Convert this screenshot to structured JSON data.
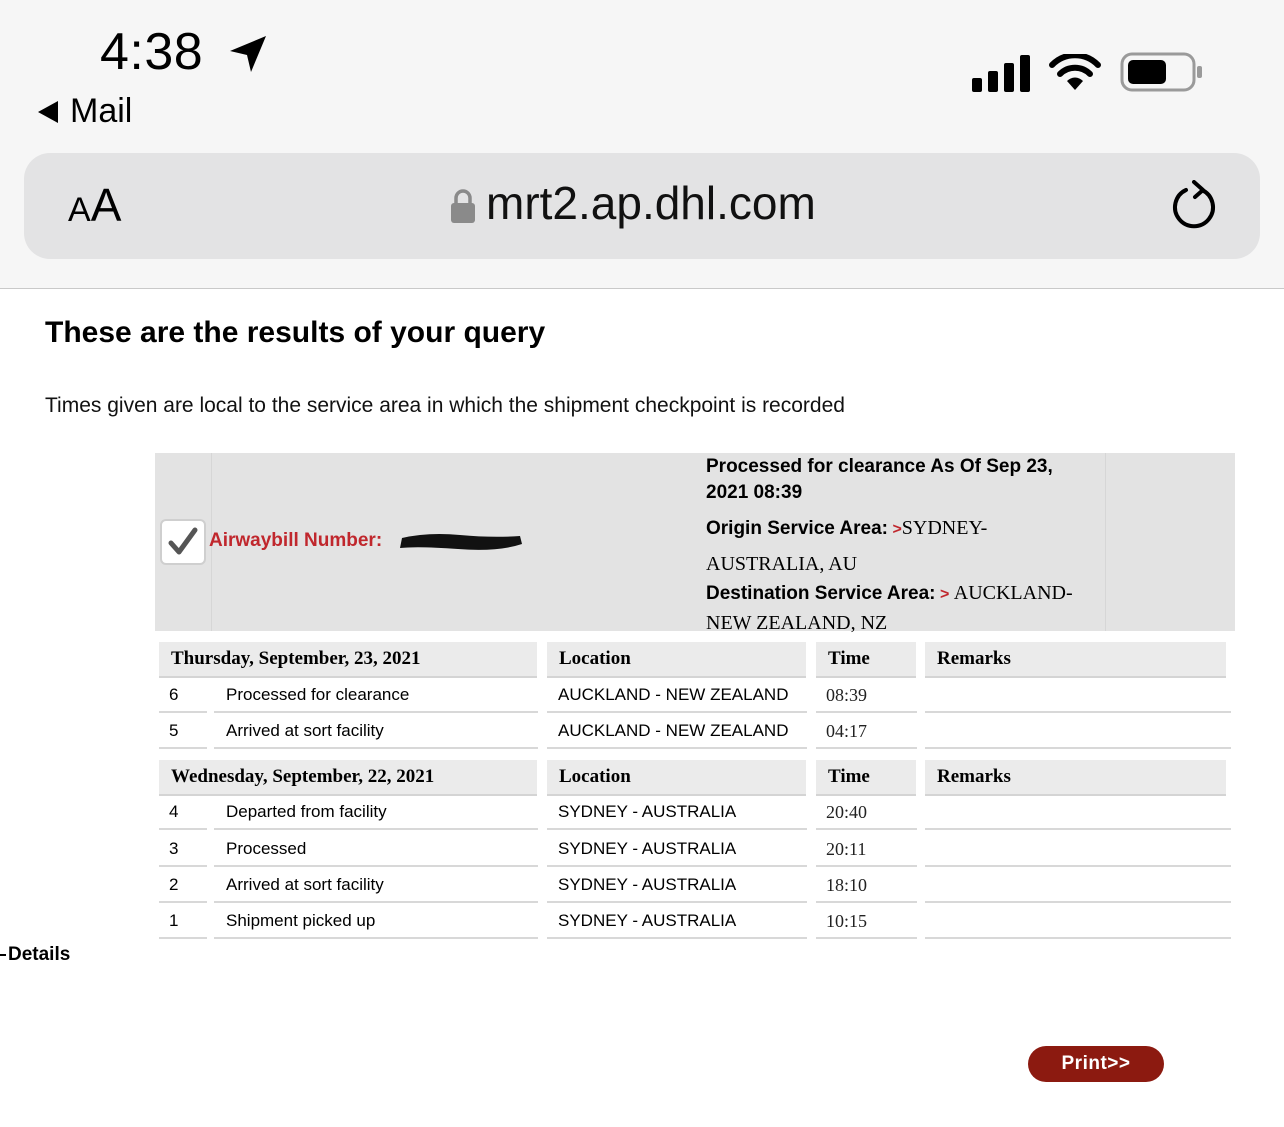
{
  "status_bar": {
    "time": "4:38",
    "back_label": "Mail",
    "icons": [
      "location-arrow-icon",
      "cellular-signal-icon",
      "wifi-icon",
      "battery-icon"
    ]
  },
  "browser": {
    "text_size_label_small": "A",
    "text_size_label_large": "A",
    "url": "mrt2.ap.dhl.com",
    "icons": [
      "lock-icon",
      "reload-icon"
    ]
  },
  "page": {
    "heading": "These are the results of your query",
    "subtitle": "Times given are local to the service area in which the shipment checkpoint is recorded",
    "summary": {
      "awb_label": "Airwaybill Number:",
      "status": "Processed for clearance As Of Sep 23, 2021 08:39",
      "origin_label": "Origin Service Area:",
      "origin_chevron": ">",
      "origin_value": "SYDNEY-AUSTRALIA, AU",
      "destination_label": "Destination Service Area:",
      "destination_chevron": ">",
      "destination_value": "AUCKLAND-NEW ZEALAND, NZ"
    },
    "groups": [
      {
        "date": "Thursday, September, 23, 2021",
        "location_header": "Location",
        "time_header": "Time",
        "remarks_header": "Remarks",
        "rows": [
          {
            "num": "6",
            "event": "Processed for clearance",
            "location": "AUCKLAND - NEW ZEALAND",
            "time": "08:39",
            "remarks": ""
          },
          {
            "num": "5",
            "event": "Arrived at sort facility",
            "location": "AUCKLAND - NEW ZEALAND",
            "time": "04:17",
            "remarks": ""
          }
        ]
      },
      {
        "date": "Wednesday, September, 22, 2021",
        "location_header": "Location",
        "time_header": "Time",
        "remarks_header": "Remarks",
        "rows": [
          {
            "num": "4",
            "event": "Departed from facility",
            "location": "SYDNEY - AUSTRALIA",
            "time": "20:40",
            "remarks": ""
          },
          {
            "num": "3",
            "event": "Processed",
            "location": "SYDNEY - AUSTRALIA",
            "time": "20:11",
            "remarks": ""
          },
          {
            "num": "2",
            "event": "Arrived at sort facility",
            "location": "SYDNEY - AUSTRALIA",
            "time": "18:10",
            "remarks": ""
          },
          {
            "num": "1",
            "event": "Shipment picked up",
            "location": "SYDNEY - AUSTRALIA",
            "time": "10:15",
            "remarks": ""
          }
        ]
      }
    ],
    "details_label": "Details",
    "print_label": "Print>>"
  },
  "colors": {
    "accent_red": "#c0272d",
    "print_button": "#8c1a10",
    "summary_bg": "#e3e3e3",
    "header_bg": "#ebebeb"
  }
}
